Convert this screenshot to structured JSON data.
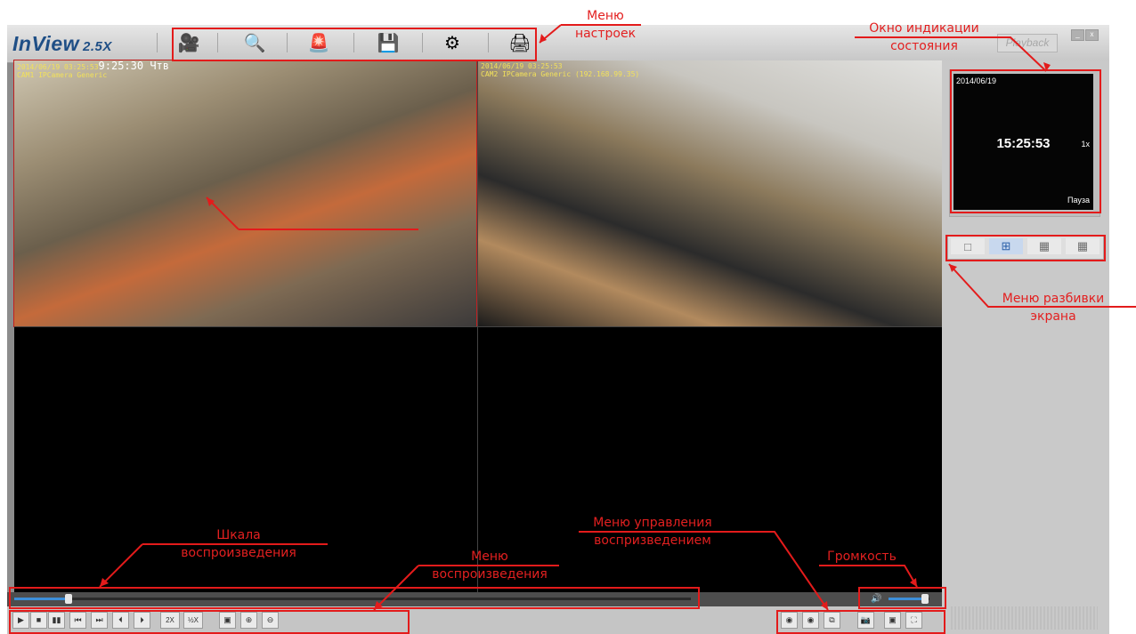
{
  "app": {
    "logo": "InView",
    "version": "2.5X",
    "playback_label": "Playback",
    "minimize_label": "_",
    "close_label": "x"
  },
  "toolbar": {
    "buttons": [
      {
        "icon": "camera-record-icon",
        "glyph": "🎥"
      },
      {
        "icon": "search-video-icon",
        "glyph": "🔍"
      },
      {
        "icon": "alarm-icon",
        "glyph": "🚨"
      },
      {
        "icon": "database-backup-icon",
        "glyph": "💾"
      },
      {
        "icon": "settings-monitor-icon",
        "glyph": "⚙"
      },
      {
        "icon": "printer-icon",
        "glyph": "🖨"
      }
    ]
  },
  "cameras": [
    {
      "timestamp": "2014/06/19 03:25:53",
      "clock": "9:25:30 Чтв",
      "label": "CAM1 IPCamera Generic"
    },
    {
      "timestamp": "2014/06/19 03:25:53",
      "clock": "",
      "label": "CAM2 IPCamera Generic (192.168.99.35)"
    }
  ],
  "status": {
    "date": "2014/06/19",
    "time": "15:25:53",
    "speed": "1x",
    "state": "Пауза"
  },
  "split_buttons": [
    {
      "icon": "layout-1-icon",
      "glyph": "□"
    },
    {
      "icon": "layout-4-icon",
      "glyph": "⊞"
    },
    {
      "icon": "layout-9-icon",
      "glyph": "▦"
    },
    {
      "icon": "layout-16-icon",
      "glyph": "▦"
    }
  ],
  "timeline": {
    "position": 0.08
  },
  "volume": {
    "level": 0.9,
    "icon": "speaker-icon"
  },
  "playback_controls": [
    {
      "name": "play-button",
      "glyph": "▶"
    },
    {
      "name": "stop-button",
      "glyph": "■"
    },
    {
      "name": "pause-button",
      "glyph": "▮▮"
    },
    {
      "name": "skip-start-button",
      "glyph": "⏮"
    },
    {
      "name": "skip-end-button",
      "glyph": "⏭"
    },
    {
      "name": "frame-back-button",
      "glyph": "⏴"
    },
    {
      "name": "frame-forward-button",
      "glyph": "⏵"
    },
    {
      "name": "speed-2x-button",
      "glyph": "2X"
    },
    {
      "name": "speed-half-button",
      "glyph": "½X"
    },
    {
      "name": "snapshot-image-button",
      "glyph": "▣"
    },
    {
      "name": "zoom-in-button",
      "glyph": "⊕"
    },
    {
      "name": "zoom-out-button",
      "glyph": "⊖"
    }
  ],
  "right_controls": [
    {
      "name": "ptz-pin-button",
      "glyph": "◉"
    },
    {
      "name": "ptz-pin-2-button",
      "glyph": "◉"
    },
    {
      "name": "ptz-window-button",
      "glyph": "⧉"
    },
    {
      "name": "camera-snapshot-button",
      "glyph": "📷"
    },
    {
      "name": "record-button",
      "glyph": "▣"
    },
    {
      "name": "fullscreen-button",
      "glyph": "⛶"
    }
  ],
  "annotations": {
    "settings_menu_1": "Меню",
    "settings_menu_2": "настроек",
    "status_window_1": "Окно индикации",
    "status_window_2": "состояния",
    "split_menu_1": "Меню разбивки",
    "split_menu_2": "экрана",
    "timeline_1": "Шкала",
    "timeline_2": "воспроизведения",
    "playback_menu_1": "Меню",
    "playback_menu_2": "воспроизведения",
    "playback_control_1": "Меню управления",
    "playback_control_2": "воспризведением",
    "volume": "Громкость"
  }
}
